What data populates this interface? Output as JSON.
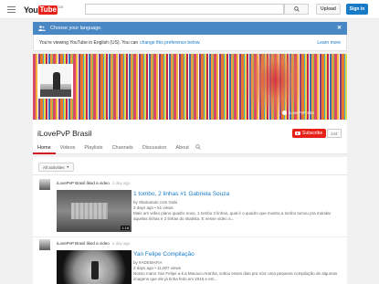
{
  "masthead": {
    "logo_you": "You",
    "logo_tube": "Tube",
    "logo_country": "DE",
    "upload_label": "Upload",
    "signin_label": "Sign in"
  },
  "notice": {
    "heading": "Choose your language.",
    "body_prefix": "You're viewing YouTube in English (US). You can",
    "body_link": "change this preference below.",
    "learn_more": "Learn more"
  },
  "channel": {
    "title": "iLovePvP Brasil",
    "banner_link": "iLovePvP Site",
    "subscribe_label": "Subscribe",
    "subscriber_count": "144"
  },
  "tabs": [
    {
      "label": "Home"
    },
    {
      "label": "Videos"
    },
    {
      "label": "Playlists"
    },
    {
      "label": "Channels"
    },
    {
      "label": "Discussion"
    },
    {
      "label": "About"
    }
  ],
  "feed": {
    "filter_label": "All activities",
    "items": [
      {
        "activity": "iLovePvP Brasil liked a video",
        "when": "1 day ago",
        "title": "1 tombo, 2 linhas #1 Gabriela Souza",
        "byline": "by Skatoando com Gabi",
        "meta": "3 days ago • 51 views",
        "description": "Mais um video plano quadro novo, 1 tombo 2 linhas, qual é o quadro que mostra a tombo tomou pra mandar aquelas linhas e 2 linhas do skatista. E nesse video a...",
        "duration": "1:18"
      },
      {
        "activity": "iLovePvP Brasil liked a video",
        "when": "1 day ago",
        "title": "Yan Felipe Compilação",
        "byline": "by #ADEMAFIA",
        "meta": "3 days ago • 11,007 views",
        "description": "Nosso mano Yan Felipe a.k.a Macaco-Aranha, soltou esses dias pra nóiz uma pequena compilação de algumas imagens que ele já tinha feito em 2015 e em..."
      }
    ]
  },
  "colors": {
    "brand_red": "#e62117",
    "link_blue": "#167ac6",
    "notice_blue": "#4a87c5"
  }
}
